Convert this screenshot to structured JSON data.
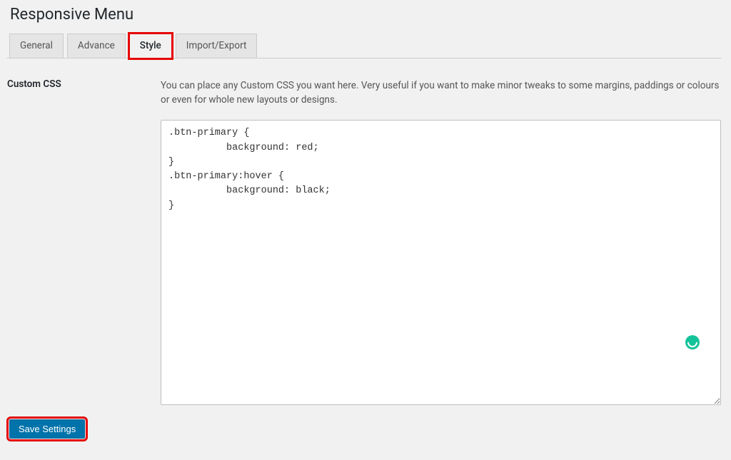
{
  "page": {
    "title": "Responsive Menu"
  },
  "tabs": {
    "general": "General",
    "advance": "Advance",
    "style": "Style",
    "import_export": "Import/Export"
  },
  "field": {
    "label": "Custom CSS",
    "description": "You can place any Custom CSS you want here. Very useful if you want to make minor tweaks to some margins, paddings or colours or even for whole new layouts or designs.",
    "value": ".btn-primary {\n          background: red;\n}\n.btn-primary:hover {\n          background: black;\n}"
  },
  "buttons": {
    "save": "Save Settings"
  }
}
